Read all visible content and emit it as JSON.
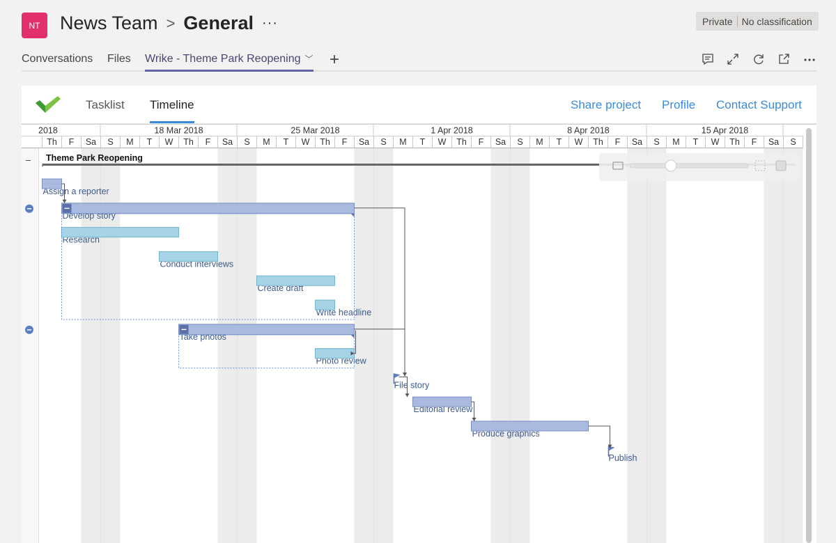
{
  "team": {
    "avatar_initials": "NT",
    "avatar_color": "#e2306c",
    "team_name": "News Team",
    "separator": ">",
    "channel_name": "General",
    "more": "···",
    "privacy": "Private",
    "classification": "No classification"
  },
  "tabs": [
    {
      "label": "Conversations",
      "active": false
    },
    {
      "label": "Files",
      "active": false
    },
    {
      "label": "Wrike - Theme Park Reopening",
      "active": true
    }
  ],
  "tab_dropdown": "﹀",
  "add_tab": "+",
  "toolbar_icons": [
    "conversation-icon",
    "expand-icon",
    "refresh-icon",
    "popout-icon",
    "more-icon"
  ],
  "app": {
    "tabs": [
      {
        "label": "Tasklist",
        "active": false
      },
      {
        "label": "Timeline",
        "active": true
      }
    ],
    "links": [
      "Share project",
      "Profile",
      "Contact Support"
    ],
    "accent": "#3b8ad9"
  },
  "timeline": {
    "week_labels": [
      "2018",
      "18 Mar 2018",
      "25 Mar 2018",
      "1 Apr 2018",
      "8 Apr 2018",
      "15 Apr 2018"
    ],
    "day_labels": [
      "Th",
      "F",
      "Sa",
      "S",
      "M",
      "T",
      "W",
      "Th",
      "F",
      "Sa",
      "S",
      "M",
      "T",
      "W",
      "Th",
      "F",
      "Sa",
      "S",
      "M",
      "T",
      "W",
      "Th",
      "F",
      "Sa",
      "S",
      "M",
      "T",
      "W",
      "Th",
      "F",
      "Sa",
      "S",
      "M",
      "T",
      "W",
      "Th",
      "F",
      "Sa",
      "S"
    ],
    "project": {
      "name": "Theme Park Reopening"
    },
    "tasks": [
      {
        "name": "Assign a reporter",
        "start": "2018-03-15",
        "end": "2018-03-15",
        "kind": "task"
      },
      {
        "name": "Develop story",
        "start": "2018-03-16",
        "end": "2018-03-30",
        "kind": "group"
      },
      {
        "name": "Research",
        "start": "2018-03-16",
        "end": "2018-03-21",
        "kind": "subtask"
      },
      {
        "name": "Conduct interviews",
        "start": "2018-03-21",
        "end": "2018-03-23",
        "kind": "subtask"
      },
      {
        "name": "Create draft",
        "start": "2018-03-26",
        "end": "2018-03-29",
        "kind": "subtask"
      },
      {
        "name": "Write headline",
        "start": "2018-03-29",
        "end": "2018-03-29",
        "kind": "subtask"
      },
      {
        "name": "Take photos",
        "start": "2018-03-22",
        "end": "2018-03-30",
        "kind": "group"
      },
      {
        "name": "Photo review",
        "start": "2018-03-29",
        "end": "2018-03-30",
        "kind": "subtask"
      },
      {
        "name": "File story",
        "start": "2018-04-02",
        "end": "2018-04-02",
        "kind": "milestone"
      },
      {
        "name": "Editorial review",
        "start": "2018-04-03",
        "end": "2018-04-05",
        "kind": "task"
      },
      {
        "name": "Produce graphics",
        "start": "2018-04-06",
        "end": "2018-04-11",
        "kind": "task"
      },
      {
        "name": "Publish",
        "start": "2018-04-13",
        "end": "2018-04-13",
        "kind": "milestone"
      }
    ],
    "colors": {
      "task_bar": "#a9b9e0",
      "subtask_bar": "#a6d4e6",
      "weekend": "#ececec",
      "label": "#3b5a8c"
    }
  }
}
